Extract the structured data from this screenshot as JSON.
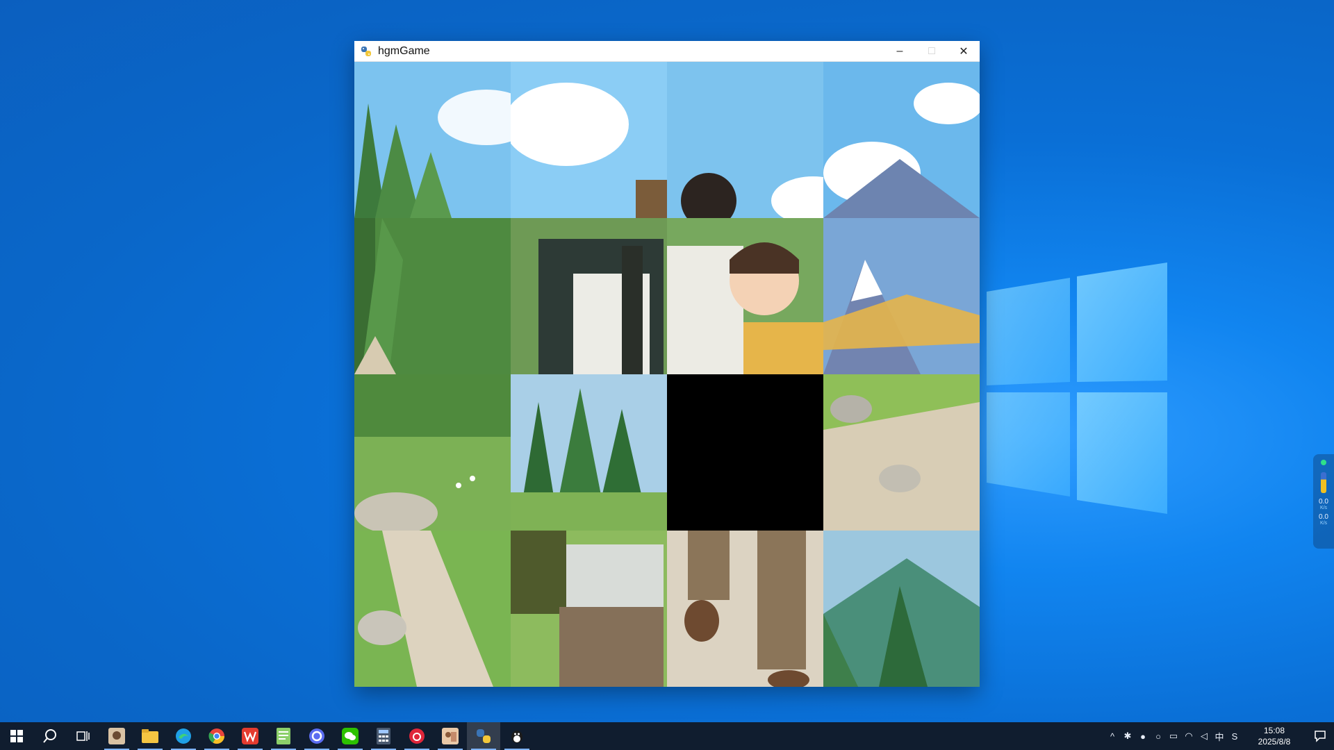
{
  "window": {
    "title": "hgmGame",
    "icon": "python-icon",
    "buttons": {
      "minimize": "–",
      "maximize": "□",
      "close": "✕"
    }
  },
  "board": {
    "grid": "4x4",
    "empty_tile": {
      "row": 2,
      "col": 3
    }
  },
  "taskbar": {
    "apps": [
      {
        "name": "start-button",
        "running": false
      },
      {
        "name": "search-button",
        "running": false
      },
      {
        "name": "task-view-button",
        "running": false
      },
      {
        "name": "photo-app",
        "running": true
      },
      {
        "name": "file-explorer",
        "running": true
      },
      {
        "name": "edge-browser",
        "running": true
      },
      {
        "name": "chrome-browser",
        "running": true
      },
      {
        "name": "wps-office",
        "running": true
      },
      {
        "name": "notepad-editor",
        "running": true
      },
      {
        "name": "browser-circle",
        "running": true
      },
      {
        "name": "wechat",
        "running": true
      },
      {
        "name": "calculator",
        "running": true
      },
      {
        "name": "netease-music",
        "running": true
      },
      {
        "name": "image-viewer",
        "running": true
      },
      {
        "name": "python-app",
        "running": true,
        "active": true
      },
      {
        "name": "qq-app",
        "running": true
      }
    ],
    "clock": {
      "time": "15:08",
      "date": "2025/8/8"
    },
    "ime": "中"
  },
  "net_widget": {
    "up": "0.0",
    "up_unit": "K/s",
    "down": "0.0",
    "down_unit": "K/s"
  },
  "colors": {
    "taskbar": "#101d2f",
    "desktop": "#0a6fd6",
    "empty_tile": "#000000"
  }
}
